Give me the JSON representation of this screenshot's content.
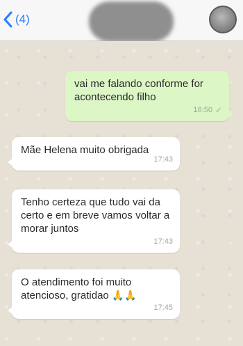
{
  "header": {
    "back_count": "(4)"
  },
  "messages": [
    {
      "direction": "out",
      "text": "vai me falando conforme for acontecendo filho",
      "time": "16:50",
      "status_icon": "single-check-icon"
    },
    {
      "direction": "in",
      "text": "Mãe Helena muito obrigada",
      "time": "17:43"
    },
    {
      "direction": "in",
      "text": "Tenho certeza que tudo vai da certo e em breve vamos voltar a morar juntos",
      "time": "17:43"
    },
    {
      "direction": "in",
      "text": "O atendimento foi muito atencioso, gratidao",
      "emoji": "🙏🙏",
      "time": "17:45"
    }
  ]
}
